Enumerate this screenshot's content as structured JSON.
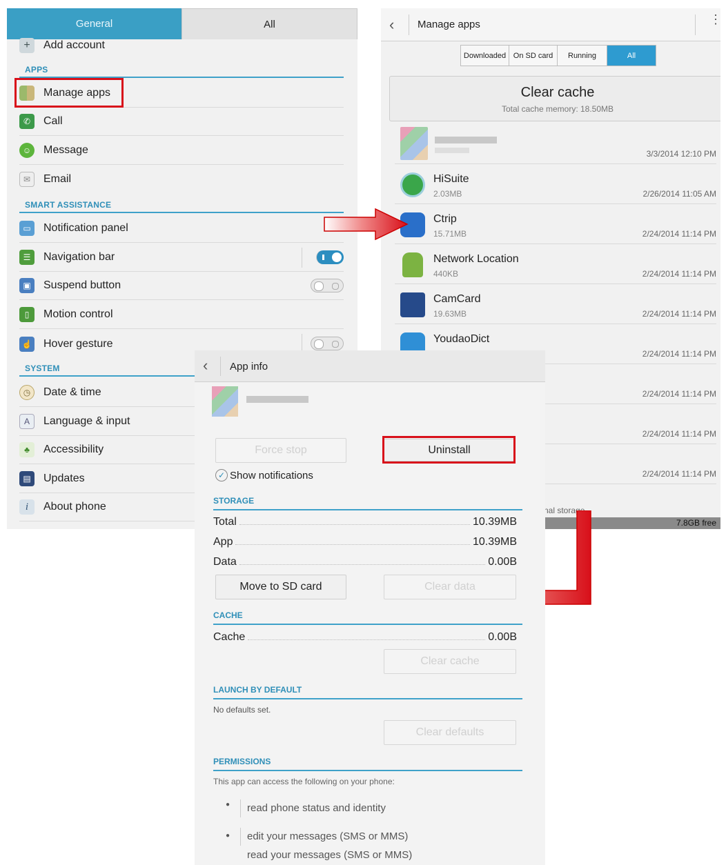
{
  "settings": {
    "tabs": {
      "general": "General",
      "all": "All"
    },
    "add_account": "Add account",
    "sections": {
      "apps": "APPS",
      "smart": "SMART ASSISTANCE",
      "system": "SYSTEM"
    },
    "apps_items": [
      "Manage apps",
      "Call",
      "Message",
      "Email"
    ],
    "smart_items": [
      "Notification panel",
      "Navigation bar",
      "Suspend button",
      "Motion control",
      "Hover gesture"
    ],
    "system_items": [
      "Date & time",
      "Language & input",
      "Accessibility",
      "Updates",
      "About phone"
    ],
    "toggles": {
      "navigation_bar": "on",
      "suspend_button": "off",
      "hover_gesture": "off"
    }
  },
  "manage": {
    "title": "Manage apps",
    "segments": [
      "Downloaded",
      "On SD card",
      "Running",
      "All"
    ],
    "active_segment": "All",
    "clear_cache": {
      "label": "Clear cache",
      "sub": "Total cache memory: 18.50MB"
    },
    "apps": [
      {
        "name": "",
        "size": "",
        "date": "3/3/2014 12:10 PM"
      },
      {
        "name": "HiSuite",
        "size": "2.03MB",
        "date": "2/26/2014 11:05 AM"
      },
      {
        "name": "Ctrip",
        "size": "15.71MB",
        "date": "2/24/2014 11:14 PM"
      },
      {
        "name": "Network Location",
        "size": "440KB",
        "date": "2/24/2014 11:14 PM"
      },
      {
        "name": "CamCard",
        "size": "19.63MB",
        "date": "2/24/2014 11:14 PM"
      },
      {
        "name": "YoudaoDict",
        "size": "",
        "date": "2/24/2014 11:14 PM"
      },
      {
        "name": "",
        "size": "",
        "date": "2/24/2014 11:14 PM"
      },
      {
        "name": "",
        "size": "",
        "date": "2/24/2014 11:14 PM"
      },
      {
        "name": "",
        "size": "",
        "date": "2/24/2014 11:14 PM"
      }
    ],
    "storage_label": "nal storage",
    "storage_free": "7.8GB free"
  },
  "appinfo": {
    "title": "App info",
    "force_stop": "Force stop",
    "uninstall": "Uninstall",
    "show_notifications": "Show notifications",
    "storage_head": "STORAGE",
    "total_label": "Total",
    "total_val": "10.39MB",
    "app_label": "App",
    "app_val": "10.39MB",
    "data_label": "Data",
    "data_val": "0.00B",
    "move_sd": "Move to SD card",
    "clear_data": "Clear data",
    "cache_head": "CACHE",
    "cache_label": "Cache",
    "cache_val": "0.00B",
    "clear_cache": "Clear cache",
    "launch_head": "LAUNCH BY DEFAULT",
    "no_defaults": "No defaults set.",
    "clear_defaults": "Clear defaults",
    "perm_head": "PERMISSIONS",
    "perm_intro": "This app can access the following on your phone:",
    "perms": [
      "read phone status and identity",
      "edit your messages (SMS or MMS)",
      "read your messages (SMS or MMS)"
    ]
  },
  "colors": {
    "accent": "#3a9fc5",
    "highlight": "#d8101a"
  }
}
